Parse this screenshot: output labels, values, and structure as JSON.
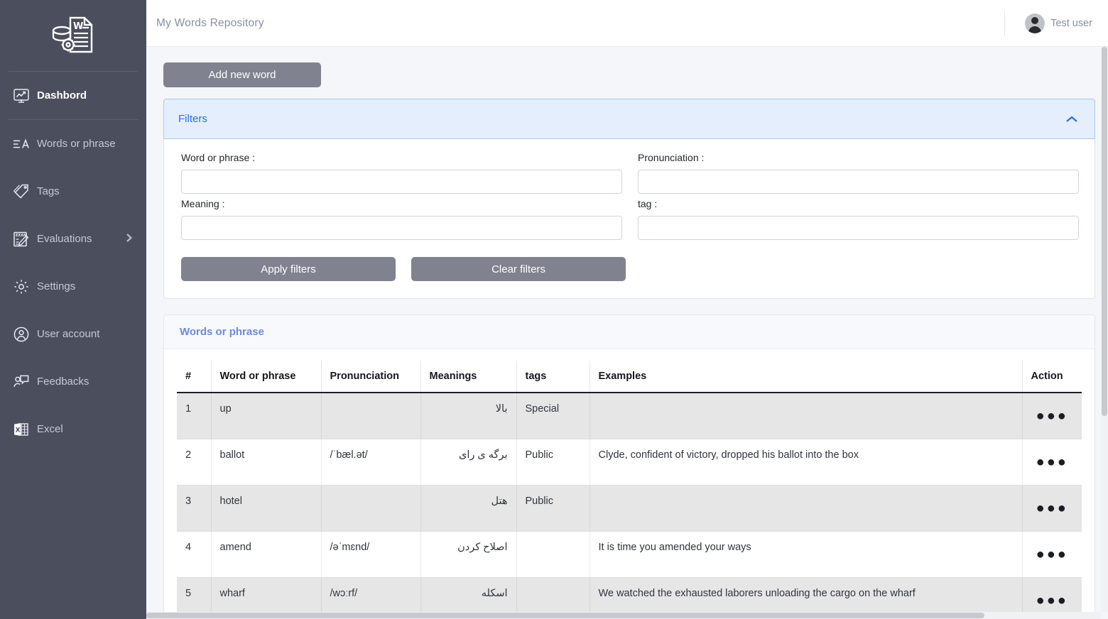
{
  "sidebar": {
    "logo_icon": "database-document-icon",
    "items": [
      {
        "label": "Dashbord",
        "icon": "dashboard-monitor-icon",
        "active": true,
        "has_chevron": false
      },
      {
        "label": "Words or phrase",
        "icon": "text-lines-a-icon",
        "active": false,
        "has_chevron": false
      },
      {
        "label": "Tags",
        "icon": "tags-icon",
        "active": false,
        "has_chevron": false
      },
      {
        "label": "Evaluations",
        "icon": "exam-sheet-icon",
        "active": false,
        "has_chevron": true
      },
      {
        "label": "Settings",
        "icon": "gear-icon",
        "active": false,
        "has_chevron": false
      },
      {
        "label": "User account",
        "icon": "user-circle-icon",
        "active": false,
        "has_chevron": false
      },
      {
        "label": "Feedbacks",
        "icon": "user-feedback-icon",
        "active": false,
        "has_chevron": false
      },
      {
        "label": "Excel",
        "icon": "excel-icon",
        "active": false,
        "has_chevron": false
      }
    ]
  },
  "topbar": {
    "title": "My Words Repository",
    "user_name": "Test user",
    "avatar_icon": "user-avatar-icon"
  },
  "toolbar": {
    "add_new_word_label": "Add new word"
  },
  "filters": {
    "title": "Filters",
    "collapse_icon": "chevron-up-icon",
    "fields": [
      {
        "label": "Word or phrase :",
        "value": "",
        "placeholder": "",
        "name": "word-or-phrase"
      },
      {
        "label": "Pronunciation :",
        "value": "",
        "placeholder": "",
        "name": "pronunciation"
      },
      {
        "label": "Meaning :",
        "value": "",
        "placeholder": "",
        "name": "meaning"
      },
      {
        "label": "tag :",
        "value": "",
        "placeholder": "",
        "name": "tag"
      }
    ],
    "apply_label": "Apply filters",
    "clear_label": "Clear filters"
  },
  "table": {
    "section_title": "Words or phrase",
    "columns": [
      "#",
      "Word or phrase",
      "Pronunciation",
      "Meanings",
      "tags",
      "Examples",
      "Action"
    ],
    "action_icon": "ellipsis-horizontal-icon",
    "rows": [
      {
        "num": "1",
        "word": "up",
        "pronunciation": "",
        "meaning": "بالا",
        "tags": "Special",
        "example": ""
      },
      {
        "num": "2",
        "word": "ballot",
        "pronunciation": "/ˈbæl.ət/",
        "meaning": "برگه ی رای",
        "tags": "Public",
        "example": "Clyde, confident of victory, dropped his ballot into the box"
      },
      {
        "num": "3",
        "word": "hotel",
        "pronunciation": "",
        "meaning": "هتل",
        "tags": "Public",
        "example": ""
      },
      {
        "num": "4",
        "word": "amend",
        "pronunciation": "/əˈmɛnd/",
        "meaning": "اصلاح کردن",
        "tags": "",
        "example": "It is time you amended your ways"
      },
      {
        "num": "5",
        "word": "wharf",
        "pronunciation": "/wɔːrf/",
        "meaning": "اسکله",
        "tags": "",
        "example": "We watched the exhausted laborers unloading the cargo on the wharf"
      }
    ]
  },
  "colors": {
    "sidebar_bg": "#4b4e5d",
    "accent_blue": "#2f6fe0",
    "filters_panel_bg": "#e4eefc",
    "button_gray": "#80828f",
    "table_title_blue": "#6c8bd8",
    "row_alt_bg": "#e6e6e6"
  }
}
